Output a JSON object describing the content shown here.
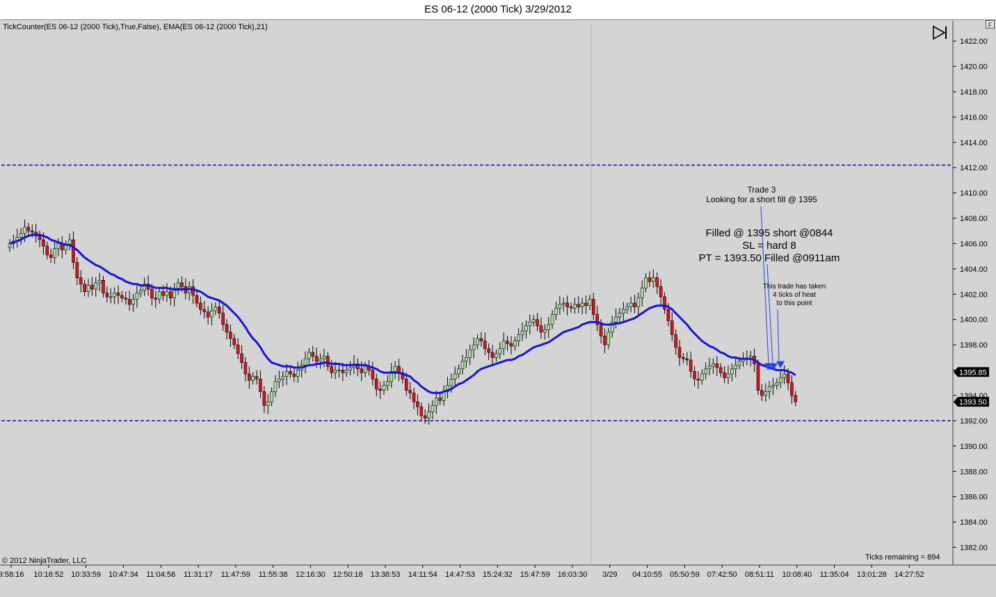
{
  "window": {
    "title": "ES 06-12 (2000 Tick)  3/29/2012",
    "f_button": "F"
  },
  "indicators_label": "TickCounter(ES 06-12 (2000 Tick),True,False), EMA(ES 06-12 (2000 Tick),21)",
  "copyright": "© 2012 NinjaTrader, LLC",
  "ticks_remaining": "Ticks remaining = 894",
  "annotations": {
    "trade_title": "Trade 3",
    "trade_desc": "Looking for a short fill @ 1395",
    "fill_line1": "Filled @ 1395 short @0844",
    "fill_line2": "SL = hard 8",
    "fill_line3": "PT = 1393.50 Filled @0911am",
    "heat_line1": "This trade has taken",
    "heat_line2": "4 ticks of heat",
    "heat_line3": "to this point"
  },
  "colors": {
    "background": "#d4d4d4",
    "bull_candle": "#a8e6a0",
    "bear_candle": "#e0151b",
    "ema": "#1414dc",
    "level_line": "#1414dc",
    "marker": "#1e46e6"
  },
  "chart_data": {
    "type": "candlestick",
    "instrument": "ES 06-12 (2000 Tick)",
    "ylim": [
      1380.6,
      1423.6
    ],
    "y_ticks": [
      "1422.00",
      "1420.00",
      "1418.00",
      "1416.00",
      "1414.00",
      "1412.00",
      "1410.00",
      "1408.00",
      "1406.00",
      "1404.00",
      "1402.00",
      "1400.00",
      "1398.00",
      "1396.00",
      "1394.00",
      "1392.00",
      "1390.00",
      "1388.00",
      "1386.00",
      "1384.00",
      "1382.00"
    ],
    "x_ticks": [
      "9:58:16",
      "10:16:52",
      "10:33:59",
      "10:47:34",
      "11:04:56",
      "11:31:17",
      "11:47:59",
      "11:55:38",
      "12:16:30",
      "12:50:18",
      "13:38:53",
      "14:11:54",
      "14:47:53",
      "15:24:32",
      "15:47:59",
      "16:03:30",
      "3/29",
      "04:10:55",
      "05:50:59",
      "07:42:50",
      "08:51:11",
      "10:08:40",
      "11:35:04",
      "13:01:28",
      "14:27:52"
    ],
    "x_tick_index": [
      0,
      10,
      20,
      30,
      40,
      50,
      60,
      70,
      80,
      90,
      100,
      110,
      120,
      130,
      140,
      150,
      160,
      170,
      180,
      190,
      200,
      210,
      220,
      230,
      240
    ],
    "day_separator_index": 155,
    "horizontal_lines": [
      1412.2,
      1392.0
    ],
    "price_markers": [
      {
        "label": "1395.85",
        "value": 1395.85
      },
      {
        "label": "1393.50",
        "value": 1393.5
      }
    ],
    "close": [
      1406.0,
      1406.2,
      1406.5,
      1406.8,
      1407.3,
      1407.0,
      1406.9,
      1406.6,
      1406.3,
      1405.8,
      1405.1,
      1404.9,
      1405.6,
      1406.0,
      1405.5,
      1405.9,
      1406.3,
      1404.5,
      1403.3,
      1402.8,
      1402.2,
      1402.7,
      1402.4,
      1402.9,
      1403.1,
      1402.1,
      1401.8,
      1401.8,
      1402.1,
      1401.9,
      1401.7,
      1401.6,
      1401.2,
      1401.6,
      1402.1,
      1402.3,
      1402.8,
      1402.4,
      1401.7,
      1401.6,
      1402.2,
      1401.9,
      1402.2,
      1401.7,
      1402.3,
      1402.9,
      1402.6,
      1402.1,
      1402.6,
      1401.9,
      1401.3,
      1400.8,
      1400.6,
      1400.2,
      1400.7,
      1401.0,
      1400.5,
      1399.6,
      1399.0,
      1398.5,
      1398.0,
      1397.3,
      1396.6,
      1395.7,
      1395.2,
      1395.5,
      1395.3,
      1394.3,
      1393.2,
      1393.5,
      1394.3,
      1395.1,
      1395.3,
      1395.5,
      1395.9,
      1395.7,
      1395.5,
      1396.0,
      1396.4,
      1396.9,
      1397.4,
      1397.1,
      1396.7,
      1396.9,
      1397.1,
      1396.3,
      1395.8,
      1396.0,
      1396.0,
      1395.8,
      1396.0,
      1396.2,
      1396.5,
      1396.1,
      1395.8,
      1396.3,
      1396.0,
      1395.3,
      1394.5,
      1394.4,
      1394.8,
      1395.1,
      1395.9,
      1396.3,
      1395.8,
      1395.3,
      1394.4,
      1394.2,
      1393.5,
      1393.1,
      1392.4,
      1392.2,
      1392.7,
      1393.2,
      1393.8,
      1393.6,
      1394.3,
      1394.8,
      1395.3,
      1395.7,
      1396.1,
      1396.7,
      1397.0,
      1397.6,
      1398.0,
      1398.5,
      1398.3,
      1397.7,
      1397.4,
      1397.0,
      1397.3,
      1397.7,
      1398.3,
      1398.1,
      1397.9,
      1398.3,
      1398.8,
      1399.1,
      1399.5,
      1399.8,
      1400.0,
      1399.5,
      1399.0,
      1399.2,
      1399.6,
      1400.4,
      1400.9,
      1401.2,
      1401.3,
      1401.0,
      1400.9,
      1401.2,
      1401.0,
      1401.3,
      1401.1,
      1401.6,
      1400.4,
      1399.6,
      1398.7,
      1398.0,
      1399.0,
      1399.8,
      1400.2,
      1400.5,
      1400.8,
      1401.0,
      1401.3,
      1401.0,
      1401.7,
      1402.5,
      1403.3,
      1403.0,
      1403.3,
      1402.6,
      1401.8,
      1400.8,
      1399.9,
      1398.8,
      1397.8,
      1397.0,
      1396.9,
      1396.8,
      1395.9,
      1395.3,
      1395.2,
      1395.7,
      1396.1,
      1396.3,
      1396.5,
      1396.2,
      1395.8,
      1395.4,
      1395.7,
      1396.1,
      1396.4,
      1396.7,
      1396.9,
      1396.9,
      1397.1,
      1396.5,
      1394.4,
      1394.0,
      1394.3,
      1394.7,
      1394.8,
      1395.0,
      1395.4,
      1395.7,
      1395.0,
      1394.0,
      1393.5
    ],
    "ema_21": [
      1406.0,
      1406.1,
      1406.2,
      1406.3,
      1406.5,
      1406.6,
      1406.7,
      1406.7,
      1406.7,
      1406.6,
      1406.5,
      1406.3,
      1406.2,
      1406.1,
      1406.0,
      1405.9,
      1405.9,
      1405.7,
      1405.5,
      1405.2,
      1404.9,
      1404.7,
      1404.5,
      1404.3,
      1404.2,
      1404.0,
      1403.8,
      1403.6,
      1403.5,
      1403.3,
      1403.2,
      1403.0,
      1402.9,
      1402.8,
      1402.8,
      1402.7,
      1402.7,
      1402.7,
      1402.6,
      1402.5,
      1402.5,
      1402.5,
      1402.5,
      1402.4,
      1402.4,
      1402.4,
      1402.4,
      1402.4,
      1402.4,
      1402.4,
      1402.3,
      1402.2,
      1402.0,
      1401.8,
      1401.7,
      1401.6,
      1401.5,
      1401.3,
      1401.1,
      1400.8,
      1400.5,
      1400.2,
      1399.8,
      1399.4,
      1398.9,
      1398.5,
      1398.2,
      1397.8,
      1397.3,
      1396.9,
      1396.6,
      1396.5,
      1396.4,
      1396.3,
      1396.3,
      1396.3,
      1396.2,
      1396.2,
      1396.2,
      1396.3,
      1396.4,
      1396.4,
      1396.5,
      1396.5,
      1396.6,
      1396.6,
      1396.5,
      1396.5,
      1396.5,
      1396.4,
      1396.4,
      1396.4,
      1396.4,
      1396.4,
      1396.4,
      1396.4,
      1396.3,
      1396.2,
      1396.1,
      1395.9,
      1395.8,
      1395.8,
      1395.8,
      1395.8,
      1395.8,
      1395.7,
      1395.6,
      1395.5,
      1395.2,
      1395.0,
      1394.7,
      1394.5,
      1394.3,
      1394.2,
      1394.2,
      1394.2,
      1394.3,
      1394.4,
      1394.5,
      1394.7,
      1394.9,
      1395.0,
      1395.2,
      1395.4,
      1395.6,
      1395.9,
      1396.1,
      1396.2,
      1396.3,
      1396.4,
      1396.5,
      1396.6,
      1396.7,
      1396.8,
      1396.8,
      1396.9,
      1397.1,
      1397.2,
      1397.4,
      1397.6,
      1397.8,
      1397.9,
      1398.0,
      1398.1,
      1398.2,
      1398.4,
      1398.6,
      1398.8,
      1399.0,
      1399.1,
      1399.2,
      1399.3,
      1399.4,
      1399.6,
      1399.7,
      1399.8,
      1399.8,
      1399.8,
      1399.7,
      1399.6,
      1399.6,
      1399.6,
      1399.7,
      1399.7,
      1399.8,
      1399.9,
      1400.0,
      1400.1,
      1400.3,
      1400.5,
      1400.7,
      1400.9,
      1401.0,
      1401.1,
      1401.1,
      1401.1,
      1401.0,
      1400.8,
      1400.5,
      1400.2,
      1399.9,
      1399.6,
      1399.2,
      1398.9,
      1398.6,
      1398.3,
      1398.1,
      1397.9,
      1397.8,
      1397.6,
      1397.4,
      1397.3,
      1397.1,
      1397.0,
      1397.0,
      1396.9,
      1396.9,
      1396.9,
      1396.9,
      1396.8,
      1396.6,
      1396.4,
      1396.3,
      1396.2,
      1396.1,
      1396.0,
      1396.0,
      1396.0,
      1395.9,
      1395.8,
      1395.6
    ]
  }
}
